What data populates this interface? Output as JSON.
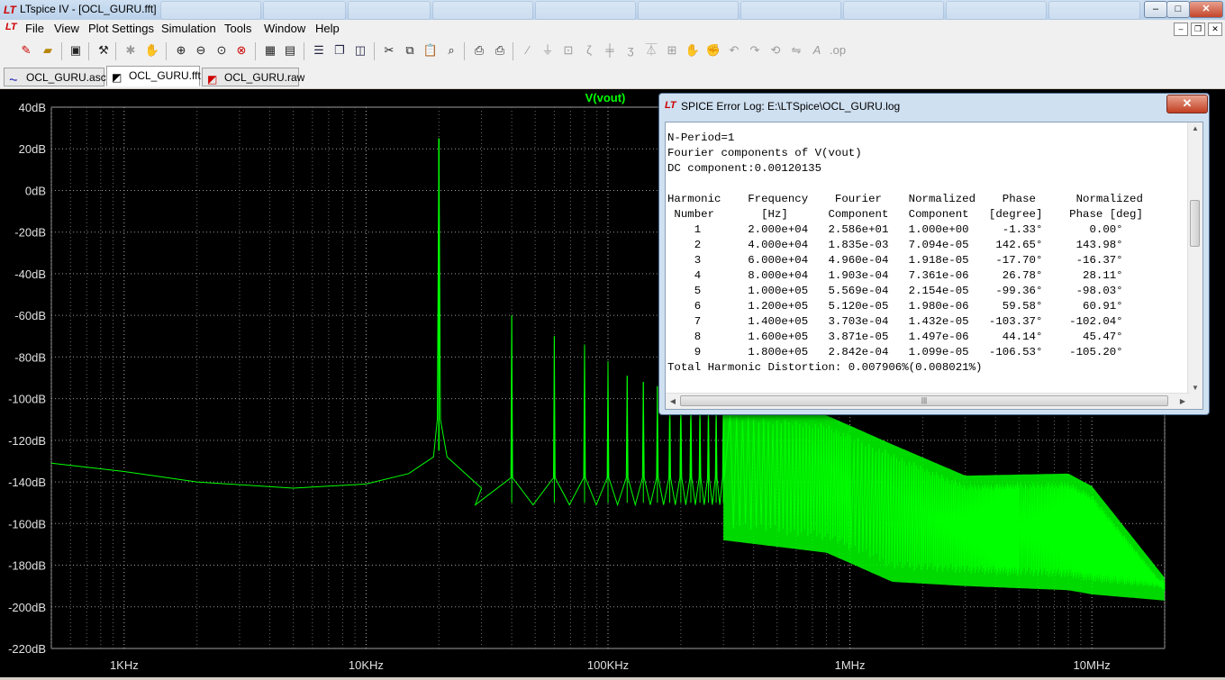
{
  "window": {
    "title": "LTspice IV - [OCL_GURU.fft]",
    "buttons": {
      "minimize": "–",
      "maximize": "□",
      "close": "✕"
    },
    "doc_buttons": {
      "minimize": "–",
      "restore": "❐",
      "close": "✕"
    }
  },
  "menu": [
    "File",
    "View",
    "Plot Settings",
    "Simulation",
    "Tools",
    "Window",
    "Help"
  ],
  "toolbar_icons": [
    "new-schematic-icon",
    "open-icon",
    "save-icon",
    "control-panel-icon",
    "run-icon",
    "halt-icon",
    "zoom-in-icon",
    "zoom-out-icon",
    "zoom-full-icon",
    "zoom-cancel-icon",
    "autorange-icon",
    "tile-horizontal-icon",
    "cascade-icon",
    "tile-vertical-icon",
    "cut-icon",
    "copy-icon",
    "paste-icon",
    "find-icon",
    "print-setup-icon",
    "print-icon",
    "wire-icon",
    "ground-icon",
    "label-icon",
    "resistor-icon",
    "capacitor-icon",
    "inductor-icon",
    "diode-icon",
    "component-icon",
    "move-icon",
    "drag-icon",
    "undo-icon",
    "redo-icon",
    "rotate-icon",
    "mirror-icon",
    "text-icon",
    "spice-directive-icon"
  ],
  "tabs": [
    {
      "label": "OCL_GURU.asc",
      "icon": "schematic-icon",
      "active": false
    },
    {
      "label": "OCL_GURU.fft",
      "icon": "fft-plot-icon",
      "active": true
    },
    {
      "label": "OCL_GURU.raw",
      "icon": "waveform-icon",
      "active": false
    }
  ],
  "chart_data": {
    "type": "line",
    "title": "V(vout)",
    "xscale": "log",
    "xlim": [
      500,
      20000000
    ],
    "ylim": [
      -220,
      40
    ],
    "x_ticks": [
      "1KHz",
      "10KHz",
      "100KHz",
      "1MHz",
      "10MHz"
    ],
    "y_ticks": [
      "40dB",
      "20dB",
      "0dB",
      "-20dB",
      "-40dB",
      "-60dB",
      "-80dB",
      "-100dB",
      "-120dB",
      "-140dB",
      "-160dB",
      "-180dB",
      "-200dB",
      "-220dB"
    ],
    "grid": true,
    "line_color": "#00ff00",
    "background": "#000000",
    "series": [
      {
        "name": "V(vout)",
        "fundamental_hz": 20000,
        "fundamental_db": 25,
        "baseline": [
          [
            500,
            -131
          ],
          [
            1000,
            -135
          ],
          [
            2000,
            -140
          ],
          [
            5000,
            -143
          ],
          [
            10000,
            -141
          ],
          [
            15000,
            -136
          ],
          [
            19000,
            -128
          ]
        ],
        "harmonic_peaks_db": [
          [
            40000,
            -60
          ],
          [
            60000,
            -70
          ],
          [
            80000,
            -74
          ],
          [
            100000,
            -82
          ],
          [
            120000,
            -89
          ],
          [
            140000,
            -92
          ],
          [
            160000,
            -94
          ],
          [
            180000,
            -96
          ],
          [
            200000,
            -96
          ],
          [
            220000,
            -98
          ],
          [
            240000,
            -100
          ],
          [
            260000,
            -101
          ],
          [
            280000,
            -101
          ],
          [
            300000,
            -102
          ]
        ],
        "noise_band": [
          [
            300000,
            -107,
            -162
          ],
          [
            800000,
            -112,
            -168
          ],
          [
            1500000,
            -126,
            -182
          ],
          [
            3000000,
            -141,
            -184
          ],
          [
            8000000,
            -140,
            -186
          ],
          [
            10000000,
            -146,
            -188
          ],
          [
            20000000,
            -190,
            -191
          ]
        ]
      }
    ]
  },
  "log_window": {
    "title": "SPICE Error Log: E:\\LTSpice\\OCL_GURU.log",
    "close": "✕",
    "lines": [
      "N-Period=1",
      "Fourier components of V(vout)",
      "DC component:0.00120135",
      "",
      "Harmonic    Frequency    Fourier    Normalized    Phase      Normalized",
      " Number       [Hz]      Component   Component   [degree]    Phase [deg]",
      "    1       2.000e+04   2.586e+01   1.000e+00     -1.33°       0.00°",
      "    2       4.000e+04   1.835e-03   7.094e-05    142.65°     143.98°",
      "    3       6.000e+04   4.960e-04   1.918e-05    -17.70°     -16.37°",
      "    4       8.000e+04   1.903e-04   7.361e-06     26.78°      28.11°",
      "    5       1.000e+05   5.569e-04   2.154e-05    -99.36°     -98.03°",
      "    6       1.200e+05   5.120e-05   1.980e-06     59.58°      60.91°",
      "    7       1.400e+05   3.703e-04   1.432e-05   -103.37°    -102.04°",
      "    8       1.600e+05   3.871e-05   1.497e-06     44.14°      45.47°",
      "    9       1.800e+05   2.842e-04   1.099e-05   -106.53°    -105.20°",
      "Total Harmonic Distortion: 0.007906%(0.008021%)"
    ]
  }
}
